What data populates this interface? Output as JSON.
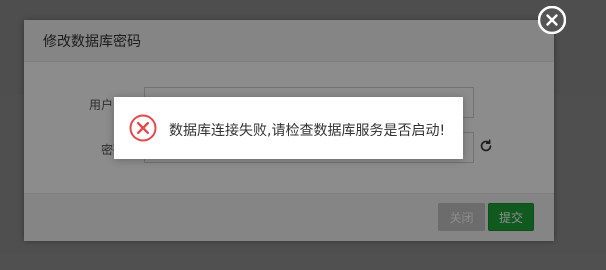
{
  "modal": {
    "title": "修改数据库密码",
    "fields": {
      "username_label": "用户:",
      "password_label": "密码"
    },
    "footer": {
      "close_label": "关闭",
      "submit_label": "提交"
    }
  },
  "toast": {
    "message": "数据库连接失败,请检查数据库服务是否启动!",
    "icon": "error-icon"
  },
  "colors": {
    "submit_bg": "#20a53a",
    "close_bg": "#c5c5c5",
    "error_red": "#e5484d"
  }
}
